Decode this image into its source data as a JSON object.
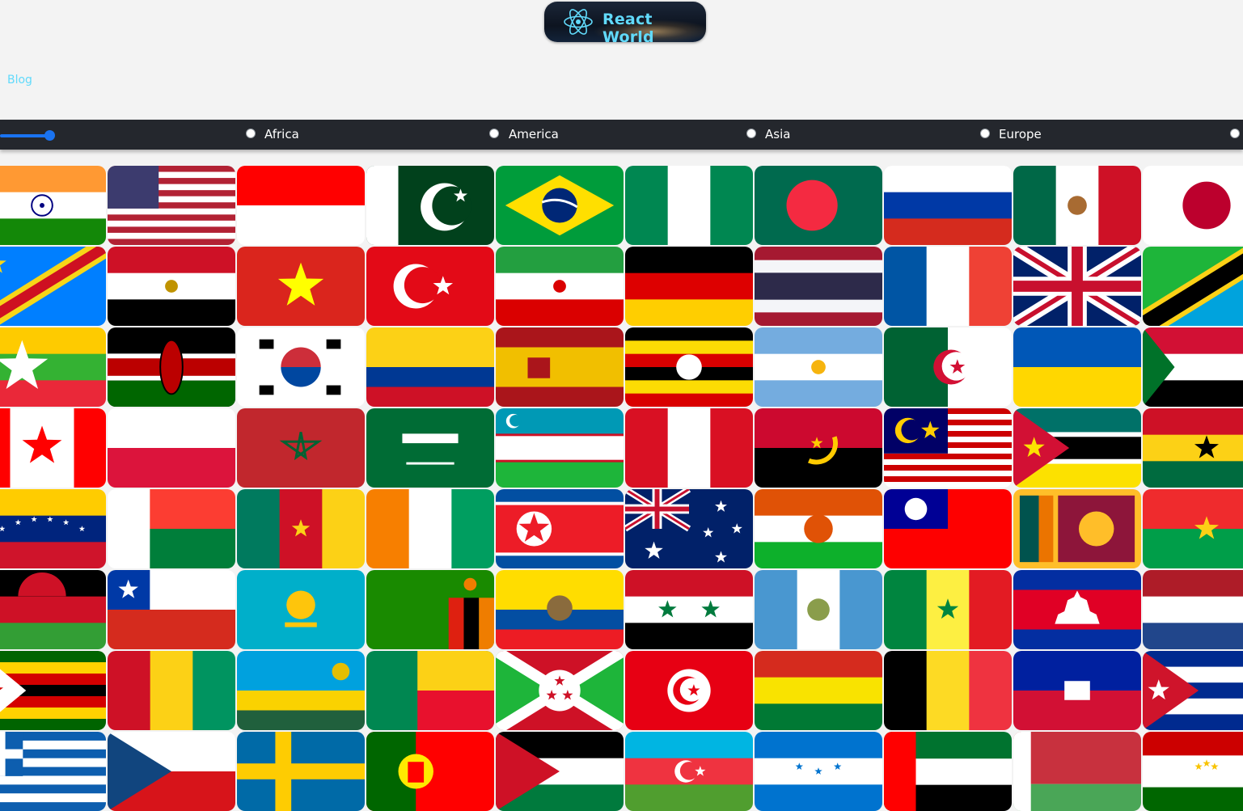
{
  "header": {
    "logo_text": "React World",
    "nav": {
      "blog_label": "Blog"
    }
  },
  "filters": {
    "regions": [
      "Africa",
      "America",
      "Asia",
      "Europe"
    ]
  },
  "flags": [
    "india",
    "usa",
    "indonesia",
    "pakistan",
    "brazil",
    "nigeria",
    "bangladesh",
    "russia",
    "mexico",
    "japan",
    "dr-congo",
    "egypt",
    "vietnam",
    "turkey",
    "iran",
    "germany",
    "thailand",
    "france",
    "united-kingdom",
    "tanzania",
    "myanmar",
    "kenya",
    "south-korea",
    "colombia",
    "spain",
    "uganda",
    "argentina",
    "algeria",
    "ukraine",
    "sudan",
    "canada",
    "poland",
    "morocco",
    "saudi-arabia",
    "uzbekistan",
    "peru",
    "angola",
    "malaysia",
    "mozambique",
    "ghana",
    "venezuela",
    "madagascar",
    "cameroon",
    "ivory-coast",
    "north-korea",
    "australia",
    "niger",
    "taiwan",
    "sri-lanka",
    "burkina-faso",
    "malawi",
    "chile",
    "kazakhstan",
    "zambia",
    "ecuador",
    "syria",
    "guatemala",
    "senegal",
    "cambodia",
    "netherlands",
    "zimbabwe",
    "guinea",
    "rwanda",
    "benin",
    "burundi",
    "tunisia",
    "bolivia",
    "belgium",
    "haiti",
    "cuba",
    "greece",
    "czechia",
    "sweden",
    "portugal",
    "jordan",
    "azerbaijan",
    "honduras",
    "uae",
    "belarus",
    "tajikistan"
  ]
}
